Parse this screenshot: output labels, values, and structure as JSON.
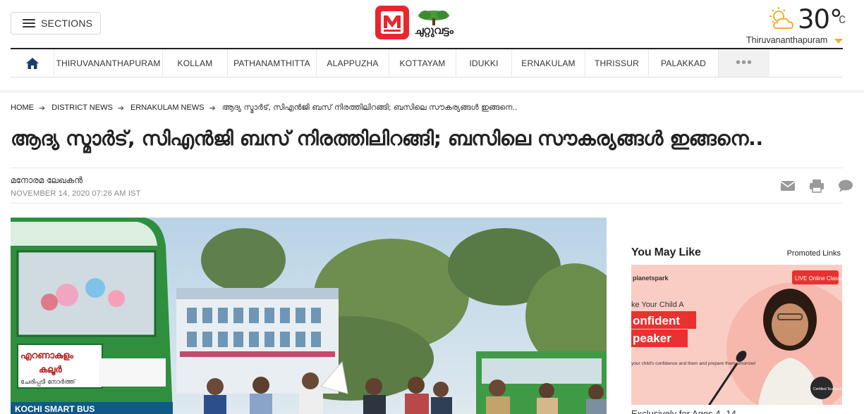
{
  "header": {
    "sections_label": "SECTIONS",
    "logo_text": "ചുറ്റുവട്ടം",
    "weather": {
      "temperature": "30°",
      "unit": "c",
      "city": "Thiruvananthapuram",
      "icon": "partly-sunny-icon"
    }
  },
  "nav": {
    "home_icon": "home-icon",
    "items": [
      {
        "label": "THIRUVANANTHAPURAM"
      },
      {
        "label": "KOLLAM"
      },
      {
        "label": "PATHANAMTHITTA"
      },
      {
        "label": "ALAPPUZHA"
      },
      {
        "label": "KOTTAYAM"
      },
      {
        "label": "IDUKKI"
      },
      {
        "label": "ERNAKULAM"
      },
      {
        "label": "THRISSUR"
      },
      {
        "label": "PALAKKAD"
      }
    ],
    "more_label": "•••"
  },
  "breadcrumb": {
    "items": [
      "HOME",
      "DISTRICT NEWS",
      "ERNAKULAM NEWS"
    ],
    "current": "ആദ്യ സ്മാർട്, സിഎൻജി ബസ് നിരത്തിലിറങ്ങി; ബസിലെ സൗകര്യങ്ങൾ ഇങ്ങനെ.."
  },
  "article": {
    "headline": "ആദ്യ സ്മാർട്, സിഎൻജി ബസ് നിരത്തിലിറങ്ങി; ബസിലെ സൗകര്യങ്ങൾ ഇങ്ങനെ..",
    "author": "മനോരമ ലേഖകൻ",
    "date": "NOVEMBER 14, 2020 07:26 AM IST",
    "share_icons": [
      "email-icon",
      "print-icon",
      "comment-icon"
    ],
    "photo_texts": {
      "bus_destination": "എറണാകുളം",
      "bus_destination_2": "കലൂർ",
      "bus_route": "ചേരിപ്പടി നോർത്ത്",
      "bus_brand": "KOCHI SMART BUS"
    }
  },
  "sidebar": {
    "title": "You May Like",
    "promoted": "Promoted Links",
    "ad": {
      "brand": "planetspark",
      "badge": "LIVE Online Classes",
      "line1": "ke Your Child A",
      "line2": "onfident",
      "line3": "peaker",
      "small": "your child's confidence and them and prepare them omorrow!",
      "seal": "Certified Teachers"
    },
    "caption": "Exclusively for Ages 4 -14"
  },
  "colors": {
    "brand_red": "#e9262f",
    "nav_border": "#222222",
    "weather_accent": "#f2b030"
  }
}
